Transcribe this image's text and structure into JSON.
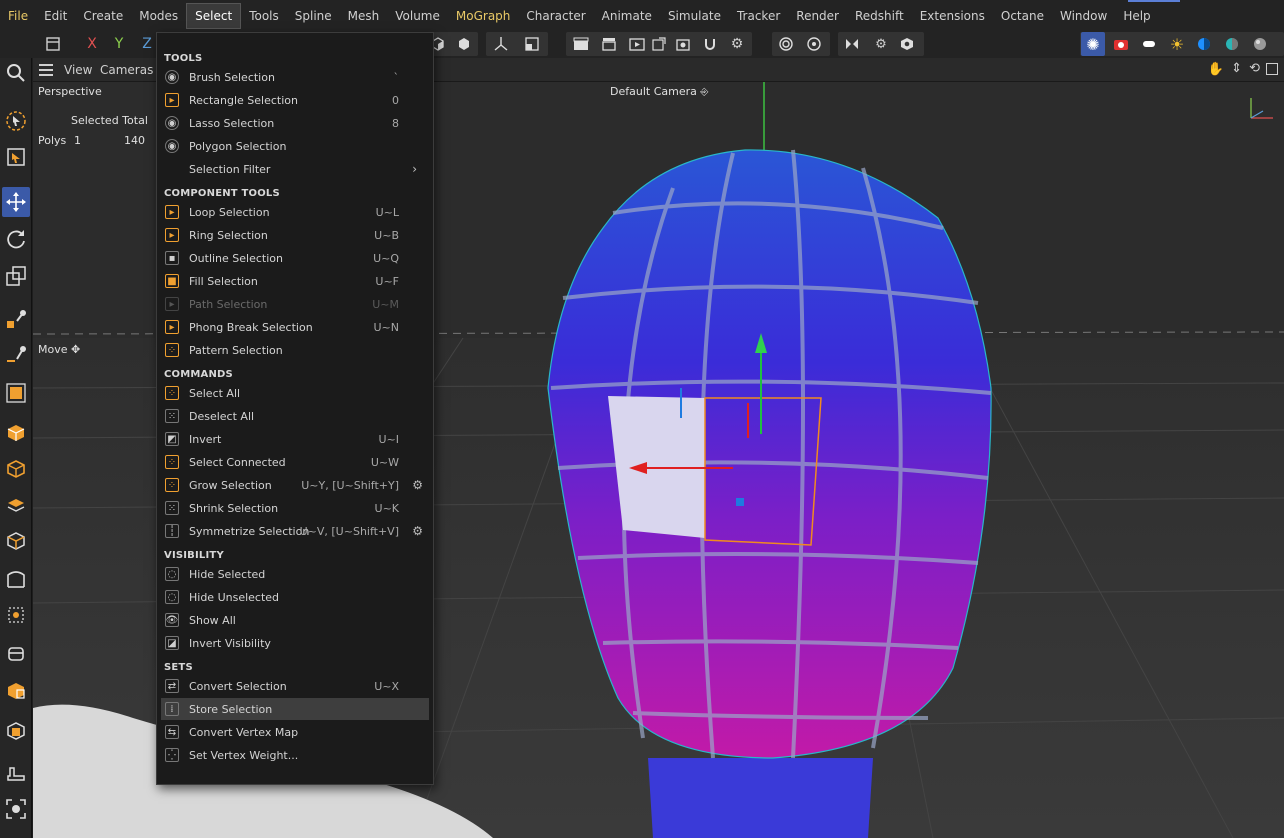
{
  "menubar": {
    "items": [
      "File",
      "Edit",
      "Create",
      "Modes",
      "Select",
      "Tools",
      "Spline",
      "Mesh",
      "Volume",
      "MoGraph",
      "Character",
      "Animate",
      "Simulate",
      "Tracker",
      "Render",
      "Redshift",
      "Extensions",
      "Octane",
      "Window",
      "Help"
    ],
    "active": "Select",
    "highlight": [
      "File",
      "MoGraph"
    ]
  },
  "toolbar": {
    "axis_x": "X",
    "axis_y": "Y",
    "axis_z": "Z"
  },
  "viewport": {
    "menu_view": "View",
    "menu_cameras": "Cameras",
    "projection": "Perspective",
    "camera_name": "Default Camera",
    "stats_header": "Selected Total",
    "stats_label": "Polys",
    "stats_selected": "1",
    "stats_total": "140",
    "tool_label": "Move"
  },
  "dropdown": {
    "sections": [
      {
        "title": "TOOLS",
        "items": [
          {
            "label": "Brush Selection",
            "shortcut": "`",
            "icon": "brush-selection-icon"
          },
          {
            "label": "Rectangle Selection",
            "shortcut": "0",
            "icon": "rectangle-selection-icon"
          },
          {
            "label": "Lasso Selection",
            "shortcut": "8",
            "icon": "lasso-selection-icon"
          },
          {
            "label": "Polygon Selection",
            "shortcut": "",
            "icon": "polygon-selection-icon"
          },
          {
            "label": "Selection Filter",
            "shortcut": "",
            "icon": "",
            "submenu": true
          }
        ]
      },
      {
        "title": "COMPONENT TOOLS",
        "items": [
          {
            "label": "Loop Selection",
            "shortcut": "U~L",
            "icon": "loop-selection-icon"
          },
          {
            "label": "Ring Selection",
            "shortcut": "U~B",
            "icon": "ring-selection-icon"
          },
          {
            "label": "Outline Selection",
            "shortcut": "U~Q",
            "icon": "outline-selection-icon"
          },
          {
            "label": "Fill Selection",
            "shortcut": "U~F",
            "icon": "fill-selection-icon"
          },
          {
            "label": "Path Selection",
            "shortcut": "U~M",
            "icon": "path-selection-icon",
            "disabled": true
          },
          {
            "label": "Phong Break Selection",
            "shortcut": "U~N",
            "icon": "phong-break-selection-icon"
          },
          {
            "label": "Pattern Selection",
            "shortcut": "",
            "icon": "pattern-selection-icon"
          }
        ]
      },
      {
        "title": "COMMANDS",
        "items": [
          {
            "label": "Select All",
            "shortcut": "",
            "icon": "select-all-icon"
          },
          {
            "label": "Deselect All",
            "shortcut": "",
            "icon": "deselect-all-icon"
          },
          {
            "label": "Invert",
            "shortcut": "U~I",
            "icon": "invert-icon"
          },
          {
            "label": "Select Connected",
            "shortcut": "U~W",
            "icon": "select-connected-icon"
          },
          {
            "label": "Grow Selection",
            "shortcut": "U~Y, [U~Shift+Y]",
            "icon": "grow-selection-icon",
            "gear": true
          },
          {
            "label": "Shrink Selection",
            "shortcut": "U~K",
            "icon": "shrink-selection-icon"
          },
          {
            "label": "Symmetrize Selection",
            "shortcut": "U~V, [U~Shift+V]",
            "icon": "symmetrize-selection-icon",
            "gear": true
          }
        ]
      },
      {
        "title": "VISIBILITY",
        "items": [
          {
            "label": "Hide Selected",
            "shortcut": "",
            "icon": "hide-selected-icon"
          },
          {
            "label": "Hide Unselected",
            "shortcut": "",
            "icon": "hide-unselected-icon"
          },
          {
            "label": "Show All",
            "shortcut": "",
            "icon": "show-all-icon"
          },
          {
            "label": "Invert Visibility",
            "shortcut": "",
            "icon": "invert-visibility-icon"
          }
        ]
      },
      {
        "title": "SETS",
        "items": [
          {
            "label": "Convert Selection",
            "shortcut": "U~X",
            "icon": "convert-selection-icon"
          },
          {
            "label": "Store Selection",
            "shortcut": "",
            "icon": "store-selection-icon",
            "hover": true
          },
          {
            "label": "Convert Vertex Map",
            "shortcut": "",
            "icon": "convert-vertex-map-icon"
          },
          {
            "label": "Set Vertex Weight...",
            "shortcut": "",
            "icon": "set-vertex-weight-icon"
          }
        ]
      }
    ]
  },
  "colors": {
    "accent_blue": "#3b5aa8",
    "orange": "#f0a030",
    "menu_highlight": "#e8c866",
    "axis_x": "#e05050",
    "axis_y": "#8ccf4d",
    "axis_z": "#5b9bd6"
  }
}
